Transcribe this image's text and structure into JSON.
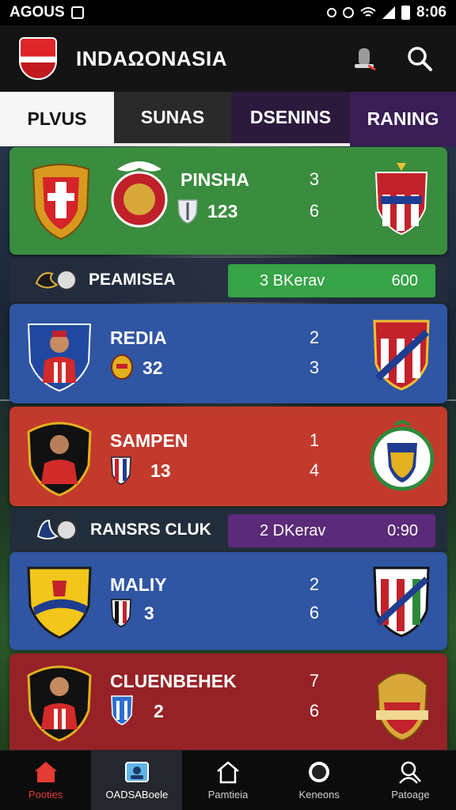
{
  "status_bar": {
    "carrier": "AGOUS",
    "time": "8:06"
  },
  "app_bar": {
    "title": "INDAΩONASIA"
  },
  "tabs": [
    {
      "label": "PLVUS"
    },
    {
      "label": "SUNAS"
    },
    {
      "label": "DSENINS"
    },
    {
      "label": "RANING"
    }
  ],
  "matches": [
    {
      "name": "PINSHA",
      "number": "123",
      "score_top": "3",
      "score_bottom": "6"
    },
    {
      "name": "REDIA",
      "number": "32",
      "score_top": "2",
      "score_bottom": "3"
    },
    {
      "name": "SAMPEN",
      "number": "13",
      "score_top": "1",
      "score_bottom": "4"
    },
    {
      "name": "MALIY",
      "number": "3",
      "score_top": "2",
      "score_bottom": "6"
    },
    {
      "name": "CLUENBEHEK",
      "number": "2",
      "score_top": "7",
      "score_bottom": "6"
    }
  ],
  "info_rows": [
    {
      "label": "PEAMISEA",
      "box_text": "3 BKerav",
      "box_value": "600",
      "box_color": "#35a346"
    },
    {
      "label": "RANSRS CLUK",
      "box_text": "2 DKerav",
      "box_value": "0:90",
      "box_color": "#5b2a78"
    }
  ],
  "bottom_nav": [
    {
      "label": "Pooties",
      "icon": "home-icon"
    },
    {
      "label": "OADSABoele",
      "icon": "profile-card-icon"
    },
    {
      "label": "Pamtieia",
      "icon": "house-outline-icon"
    },
    {
      "label": "Keneons",
      "icon": "ball-icon"
    },
    {
      "label": "Patoage",
      "icon": "user-icon"
    }
  ],
  "colors": {
    "accent_red": "#e53b34",
    "card_green": "#3a8c3e",
    "card_blue": "#2f55a3",
    "card_red": "#c23a2c",
    "card_darkred": "#962227"
  }
}
